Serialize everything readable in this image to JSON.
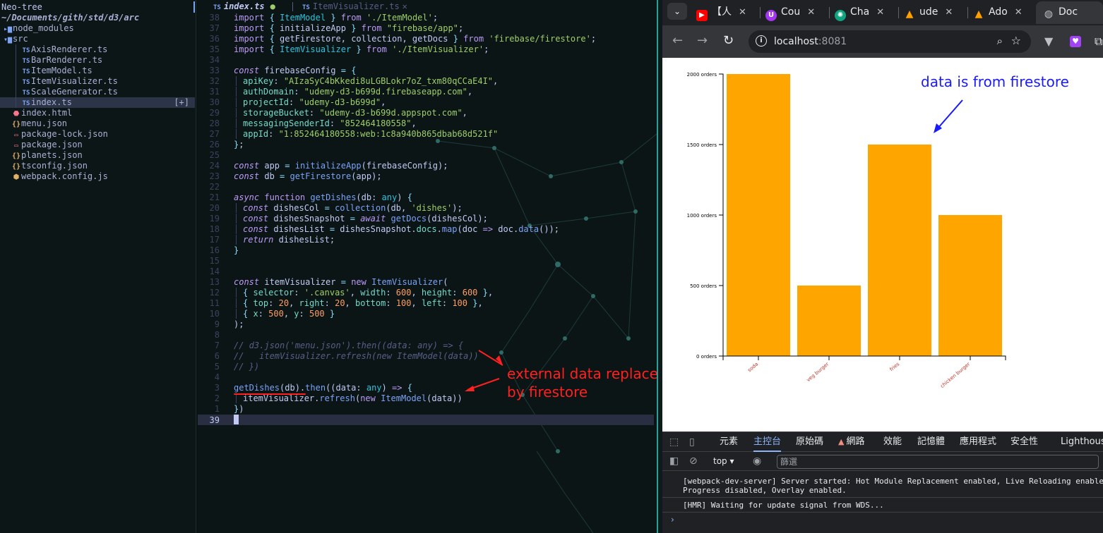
{
  "neotree": {
    "title": "Neo-tree",
    "path": "~/Documents/gith/std/d3/arc",
    "items": [
      {
        "label": "node_modules",
        "icon": "folder-icon",
        "glyph": "▸▆"
      },
      {
        "label": "src",
        "icon": "folder-open-icon",
        "glyph": "▾▆"
      },
      {
        "label": "AxisRenderer.ts",
        "icon": "typescript-icon",
        "glyph": "TS"
      },
      {
        "label": "BarRenderer.ts",
        "icon": "typescript-icon",
        "glyph": "TS"
      },
      {
        "label": "ItemModel.ts",
        "icon": "typescript-icon",
        "glyph": "TS"
      },
      {
        "label": "ItemVisualizer.ts",
        "icon": "typescript-icon",
        "glyph": "TS"
      },
      {
        "label": "ScaleGenerator.ts",
        "icon": "typescript-icon",
        "glyph": "TS"
      },
      {
        "label": "index.ts",
        "icon": "typescript-icon",
        "glyph": "TS",
        "badge": "[+]"
      },
      {
        "label": "index.html",
        "icon": "html-icon",
        "glyph": "⬣"
      },
      {
        "label": "menu.json",
        "icon": "json-icon",
        "glyph": "{}"
      },
      {
        "label": "package-lock.json",
        "icon": "package-icon",
        "glyph": "▭"
      },
      {
        "label": "package.json",
        "icon": "package-icon",
        "glyph": "▭"
      },
      {
        "label": "planets.json",
        "icon": "json-icon",
        "glyph": "{}"
      },
      {
        "label": "tsconfig.json",
        "icon": "json-icon",
        "glyph": "{}"
      },
      {
        "label": "webpack.config.js",
        "icon": "webpack-icon",
        "glyph": "⬢"
      }
    ]
  },
  "editor": {
    "tabs": [
      {
        "label": "index.ts",
        "modified_glyph": "●"
      },
      {
        "label": "ItemVisualizer.ts",
        "close_glyph": "✕"
      }
    ],
    "cursor_line_number": "39",
    "annotations": {
      "external": "external data replaced",
      "by_firestore": "by firestore"
    }
  },
  "browser": {
    "tabs": [
      {
        "label": "【人",
        "icon": "youtube-icon"
      },
      {
        "label": "Cou",
        "icon": "udemy-icon"
      },
      {
        "label": "Cha",
        "icon": "chatgpt-icon"
      },
      {
        "label": "ude",
        "icon": "firebase-icon"
      },
      {
        "label": "Ado",
        "icon": "firebase-icon"
      },
      {
        "label": "Doc",
        "icon": "globe-icon"
      }
    ],
    "url_host": "localhost",
    "url_port": ":8081",
    "annotation": "data is from firestore"
  },
  "chart_data": {
    "type": "bar",
    "categories": [
      "soda",
      "veg burger",
      "fries",
      "chicken burger"
    ],
    "values": [
      2000,
      500,
      1500,
      1000
    ],
    "yticks": [
      {
        "value": 0,
        "label": "0 orders"
      },
      {
        "value": 500,
        "label": "500 orders"
      },
      {
        "value": 1000,
        "label": "1000 orders"
      },
      {
        "value": 1500,
        "label": "1500 orders"
      },
      {
        "value": 2000,
        "label": "2000 orders"
      }
    ],
    "ylim": [
      0,
      2000
    ],
    "bar_color": "#ffa500",
    "label_color": "#c0392b"
  },
  "devtools": {
    "tabs": [
      "元素",
      "主控台",
      "原始碼",
      "網路",
      "效能",
      "記憶體",
      "應用程式",
      "安全性",
      "Lighthouse"
    ],
    "active_tab": "主控台",
    "context": "top",
    "filter_placeholder": "篩選",
    "console": [
      "[webpack-dev-server] Server started: Hot Module Replacement enabled, Live Reloading enabled,",
      "Progress disabled, Overlay enabled.",
      "[HMR] Waiting for update signal from WDS..."
    ]
  }
}
